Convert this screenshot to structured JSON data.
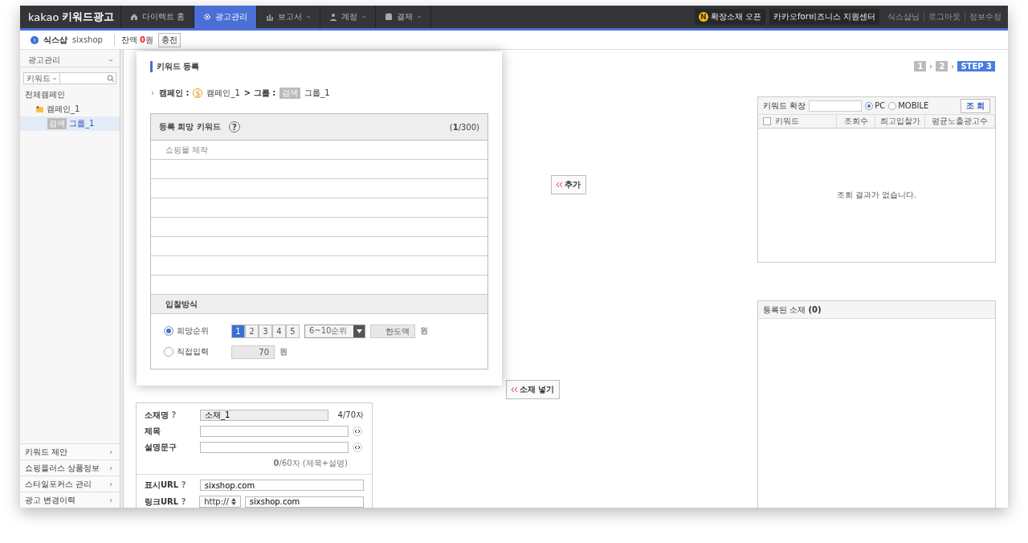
{
  "topbar": {
    "logo_brand": "kakao",
    "logo_product": "키워드광고",
    "tabs": [
      {
        "label": "다이렉트 홈",
        "dropdown": false,
        "selected": false
      },
      {
        "label": "광고관리",
        "dropdown": false,
        "selected": true
      },
      {
        "label": "보고서",
        "dropdown": true,
        "selected": false
      },
      {
        "label": "계정",
        "dropdown": true,
        "selected": false
      },
      {
        "label": "결제",
        "dropdown": true,
        "selected": false
      }
    ],
    "notice_badge": "N",
    "notice": "확장소재 오픈",
    "support": "카카오for비즈니스 지원센터",
    "links": [
      "식스샵님",
      "로그아웃",
      "정보수정"
    ]
  },
  "account": {
    "name": "식스샵",
    "id": "sixshop",
    "balance": "잔액 **0**원",
    "charge_button": "충전"
  },
  "sidebar": {
    "title": "광고관리",
    "search_type": "키워드",
    "tree": [
      {
        "label": "전체캠페인",
        "selected": false,
        "children": [
          {
            "label": "캠페인_1",
            "selected": false,
            "children": [
              {
                "label": "그룹_1",
                "tag": "검색",
                "selected": true
              }
            ]
          }
        ]
      }
    ],
    "menu": [
      "키워드 제안",
      "쇼핑플러스 상품정보",
      "스타일포커스 관리",
      "광고 변경이력"
    ]
  },
  "steps": [
    {
      "label": "1",
      "selected": false
    },
    {
      "label": "2",
      "selected": false
    },
    {
      "label": "STEP 3",
      "selected": true
    }
  ],
  "add_button": "추가",
  "insert_creative_button": "소재 넣기",
  "keyword_expand": {
    "label": "키워드 확장",
    "devices": [
      {
        "label": "PC",
        "selected": true
      },
      {
        "label": "MOBILE",
        "selected": false
      }
    ],
    "search_button": "조 회",
    "select_all_checked": false,
    "columns": [
      "키워드",
      "조회수",
      "최고입찰가",
      "평균노출광고수"
    ],
    "empty": "조회 결과가 없습니다."
  },
  "registered": {
    "title": "등록된 소재",
    "count": "(0)"
  },
  "creative_form": {
    "fields": [
      {
        "kind": "readonly",
        "label": "소재명",
        "help": "?",
        "value": "소재_1",
        "counter": "4/70자"
      },
      {
        "kind": "text",
        "label": "제목"
      },
      {
        "kind": "text",
        "label": "설명문구"
      },
      {
        "kind": "counter",
        "text": "**0**/60자 (제목+설명)"
      },
      {
        "kind": "divider"
      },
      {
        "kind": "url",
        "label": "표시URL",
        "help": "?",
        "value": "sixshop.com"
      },
      {
        "kind": "link",
        "label": "링크URL",
        "help": "?",
        "protocol": "http://",
        "value": "sixshop.com"
      }
    ]
  },
  "modal": {
    "title": "키워드 등록",
    "campaign_label": "캠페인 :",
    "campaign_icon": "$",
    "campaign": "캠페인_1",
    "group_label": "> 그룹 :",
    "group_tag": "검색",
    "group": "그룹_1",
    "keywords_header": "등록 희망 키워드",
    "help": "?",
    "keywords_count": "(**1**/300)",
    "keywords": [
      "쇼핑몰 제작"
    ],
    "bid_header": "입찰방식",
    "bid_options": [
      {
        "kind": "rank",
        "label": "희망순위",
        "selected": true,
        "ranks": [
          {
            "label": "1",
            "selected": true
          },
          {
            "label": "2",
            "selected": false
          },
          {
            "label": "3",
            "selected": false
          },
          {
            "label": "4",
            "selected": false
          },
          {
            "label": "5",
            "selected": false
          }
        ],
        "range": "6~10순위",
        "limit_placeholder": "한도액",
        "unit": "원"
      },
      {
        "kind": "direct",
        "label": "직접입력",
        "selected": false,
        "value": "70",
        "unit": "원"
      }
    ]
  }
}
